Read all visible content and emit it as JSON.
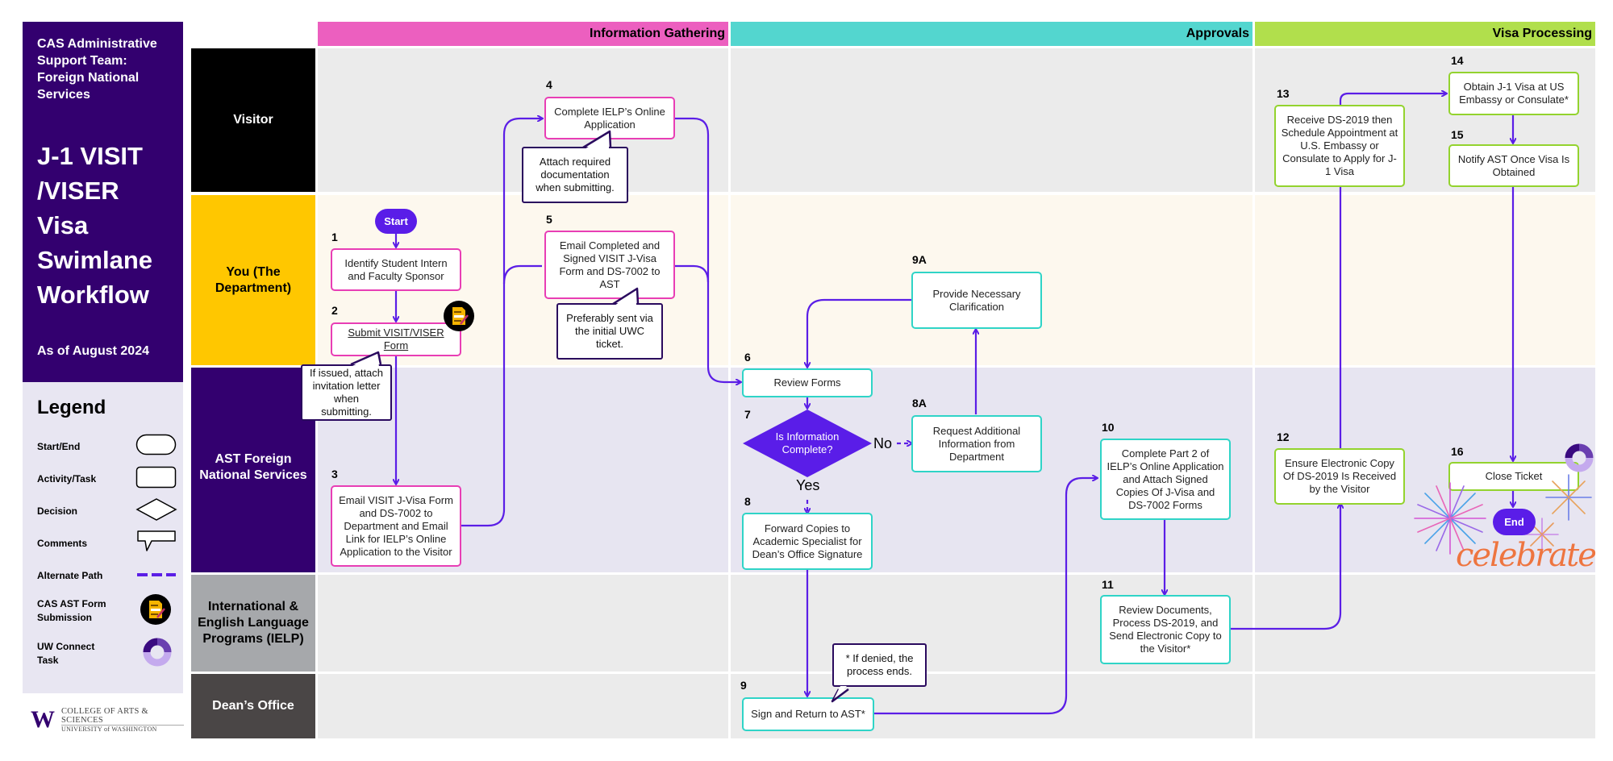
{
  "sidebar": {
    "subtitle": "CAS Administrative Support Team: Foreign National Services",
    "title": "J-1 VISIT /VISER Visa Swimlane Workflow",
    "as_of": "As of August 2024"
  },
  "legend": {
    "title": "Legend",
    "items": [
      {
        "label": "Start/End",
        "symbol": "rounded-pill"
      },
      {
        "label": "Activity/Task",
        "symbol": "rounded-rectangle"
      },
      {
        "label": "Decision",
        "symbol": "diamond"
      },
      {
        "label": "Comments",
        "symbol": "speech-bubble"
      },
      {
        "label": "Alternate Path",
        "symbol": "dashed-line"
      },
      {
        "label": "CAS AST Form Submission",
        "symbol": "form-icon"
      },
      {
        "label": "UW Connect Task",
        "symbol": "ring-icon"
      }
    ]
  },
  "logo": {
    "mark": "W",
    "line1": "COLLEGE OF ARTS & SCIENCES",
    "line2": "UNIVERSITY of WASHINGTON"
  },
  "phases": [
    {
      "label": "Information Gathering",
      "color": "#ec5fbf"
    },
    {
      "label": "Approvals",
      "color": "#53d6cf"
    },
    {
      "label": "Visa Processing",
      "color": "#b1df4c"
    }
  ],
  "lanes": [
    {
      "label": "Visitor",
      "color": "#000000",
      "bg": "#ebebeb"
    },
    {
      "label": "You (The Department)",
      "color": "#ffc700",
      "bg": "#fdf8ee"
    },
    {
      "label": "AST Foreign National Services",
      "color": "#33006f",
      "bg": "#e7e5f1"
    },
    {
      "label": "International & English Language Programs (IELP)",
      "color": "#a6a8ab",
      "bg": "#ebebeb"
    },
    {
      "label": "Dean’s Office",
      "color": "#4a4646",
      "bg": "#ebebeb"
    }
  ],
  "colors": {
    "arrow": "#5b1ee6",
    "accent": "#33006f"
  },
  "flow": {
    "start": "Start",
    "end": "End",
    "steps": {
      "s1": {
        "num": "1",
        "text": "Identify Student Intern and Faculty Sponsor"
      },
      "s2": {
        "num": "2",
        "text": "Submit VISIT/VISER Form"
      },
      "s3": {
        "num": "3",
        "text": "Email VISIT J-Visa Form and DS-7002 to Department and Email Link for IELP’s Online Application to the Visitor"
      },
      "s4": {
        "num": "4",
        "text": "Complete IELP’s Online Application"
      },
      "s5": {
        "num": "5",
        "text": "Email Completed and Signed VISIT J-Visa Form and DS-7002 to AST"
      },
      "s6": {
        "num": "6",
        "text": "Review Forms"
      },
      "s7": {
        "num": "7",
        "text": "Is Information Complete?"
      },
      "s8": {
        "num": "8",
        "text": "Forward Copies to Academic Specialist for Dean’s Office Signature"
      },
      "s8a": {
        "num": "8A",
        "text": "Request Additional Information from Department"
      },
      "s9": {
        "num": "9",
        "text": "Sign and Return to AST*"
      },
      "s9a": {
        "num": "9A",
        "text": "Provide Necessary Clarification"
      },
      "s10": {
        "num": "10",
        "text": "Complete Part 2 of IELP’s Online Application and Attach Signed Copies Of J-Visa and DS-7002 Forms"
      },
      "s11": {
        "num": "11",
        "text": "Review Documents, Process DS-2019, and Send Electronic Copy to the Visitor*"
      },
      "s12": {
        "num": "12",
        "text": "Ensure Electronic Copy Of DS-2019 Is Received by the Visitor"
      },
      "s13": {
        "num": "13",
        "text": "Receive DS-2019 then Schedule Appointment at U.S. Embassy or Consulate to Apply for J-1 Visa"
      },
      "s14": {
        "num": "14",
        "text": "Obtain J-1 Visa at US Embassy or Consulate*"
      },
      "s15": {
        "num": "15",
        "text": "Notify AST Once Visa Is Obtained"
      },
      "s16": {
        "num": "16",
        "text": "Close Ticket"
      }
    },
    "decision": {
      "yes": "Yes",
      "no": "No"
    },
    "comments": {
      "c2": "If issued, attach invitation letter when submitting.",
      "c4": "Attach required documentation when submitting.",
      "c5": "Preferably sent via the initial UWC ticket.",
      "c9": "* If denied, the process ends."
    },
    "celebrate": "celebrate"
  }
}
